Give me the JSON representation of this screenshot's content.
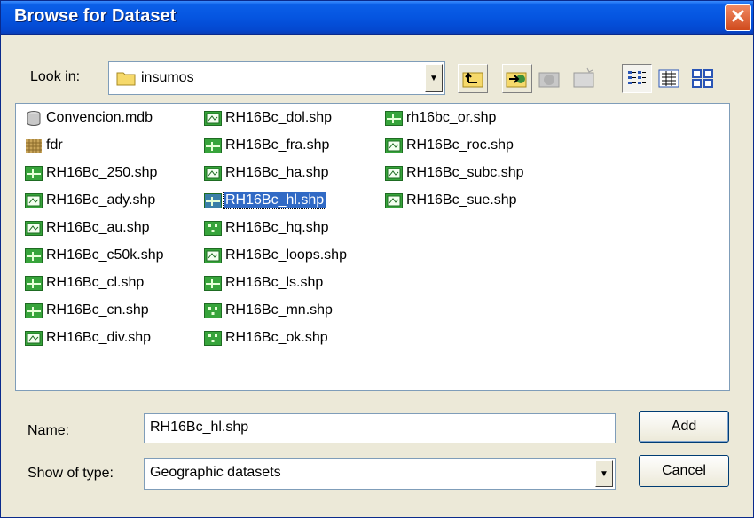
{
  "window": {
    "title": "Browse for Dataset",
    "close_glyph": "✕"
  },
  "look_in": {
    "label": "Look in:",
    "value": "insumos"
  },
  "toolbar": {
    "buttons": [
      "up-one-level",
      "connect-folder",
      "disconnect-folder",
      "new-folder",
      "list-view",
      "details-view",
      "thumbnails-view"
    ]
  },
  "files": [
    {
      "name": "Convencion.mdb",
      "icon": "database-icon"
    },
    {
      "name": "fdr",
      "icon": "raster-icon"
    },
    {
      "name": "RH16Bc_250.shp",
      "icon": "line-shapefile-icon"
    },
    {
      "name": "RH16Bc_ady.shp",
      "icon": "polygon-shapefile-icon"
    },
    {
      "name": "RH16Bc_au.shp",
      "icon": "polygon-shapefile-icon"
    },
    {
      "name": "RH16Bc_c50k.shp",
      "icon": "line-shapefile-icon"
    },
    {
      "name": "RH16Bc_cl.shp",
      "icon": "line-shapefile-icon"
    },
    {
      "name": "RH16Bc_cn.shp",
      "icon": "line-shapefile-icon"
    },
    {
      "name": "RH16Bc_div.shp",
      "icon": "polygon-shapefile-icon"
    },
    {
      "name": "RH16Bc_dol.shp",
      "icon": "polygon-shapefile-icon"
    },
    {
      "name": "RH16Bc_fra.shp",
      "icon": "line-shapefile-icon"
    },
    {
      "name": "RH16Bc_ha.shp",
      "icon": "polygon-shapefile-icon"
    },
    {
      "name": "RH16Bc_hl.shp",
      "icon": "line-shapefile-icon",
      "selected": true
    },
    {
      "name": "RH16Bc_hq.shp",
      "icon": "point-shapefile-icon"
    },
    {
      "name": "RH16Bc_loops.shp",
      "icon": "polygon-shapefile-icon"
    },
    {
      "name": "RH16Bc_ls.shp",
      "icon": "line-shapefile-icon"
    },
    {
      "name": "RH16Bc_mn.shp",
      "icon": "point-shapefile-icon"
    },
    {
      "name": "RH16Bc_ok.shp",
      "icon": "point-shapefile-icon"
    },
    {
      "name": "rh16bc_or.shp",
      "icon": "line-shapefile-icon"
    },
    {
      "name": "RH16Bc_roc.shp",
      "icon": "polygon-shapefile-icon"
    },
    {
      "name": "RH16Bc_subc.shp",
      "icon": "polygon-shapefile-icon"
    },
    {
      "name": "RH16Bc_sue.shp",
      "icon": "polygon-shapefile-icon"
    }
  ],
  "name_field": {
    "label": "Name:",
    "value": "RH16Bc_hl.shp"
  },
  "type_field": {
    "label": "Show of type:",
    "value": "Geographic datasets"
  },
  "buttons": {
    "add": "Add",
    "cancel": "Cancel"
  },
  "colors": {
    "title_bar": "#0555e0",
    "selection": "#316ac5",
    "dialog_bg": "#ece9d8"
  }
}
